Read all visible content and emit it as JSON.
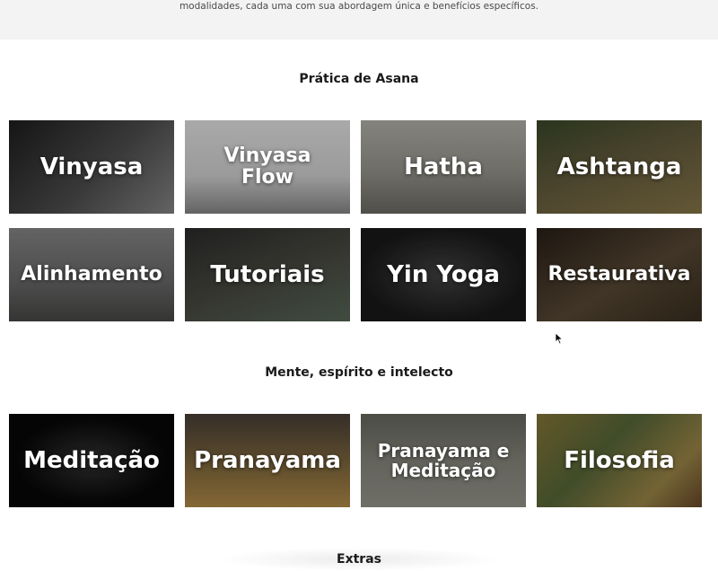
{
  "intro_text": "modalidades, cada uma com sua abordagem única e benefícios específicos.",
  "sections": {
    "asana": {
      "title": "Prática de Asana",
      "cards": [
        {
          "label": "Vinyasa"
        },
        {
          "label": "Vinyasa Flow"
        },
        {
          "label": "Hatha"
        },
        {
          "label": "Ashtanga"
        },
        {
          "label": "Alinhamento"
        },
        {
          "label": "Tutoriais"
        },
        {
          "label": "Yin Yoga"
        },
        {
          "label": "Restaurativa"
        }
      ]
    },
    "mind": {
      "title": "Mente, espírito e intelecto",
      "cards": [
        {
          "label": "Meditação"
        },
        {
          "label": "Pranayama"
        },
        {
          "label": "Pranayama e Meditação"
        },
        {
          "label": "Filosofia"
        }
      ]
    },
    "extras": {
      "title": "Extras"
    }
  },
  "colors": {
    "card_vinyasa": "#3a3a3a",
    "card_vinyasa_flow": "#b9b9b9",
    "card_hatha": "#9a9890",
    "card_ashtanga": "#5a5a3a",
    "card_alinhamento": "#7a7a7a",
    "card_tutoriais": "#3a3a36",
    "card_yin": "#1e1e1e",
    "card_restaurativa": "#4a3a2a",
    "card_meditacao": "#0c0c0c",
    "card_pranayama": "#6a5a3a",
    "card_pranayama_meditacao": "#8a8a80",
    "card_filosofia": "#6a6a3a"
  }
}
